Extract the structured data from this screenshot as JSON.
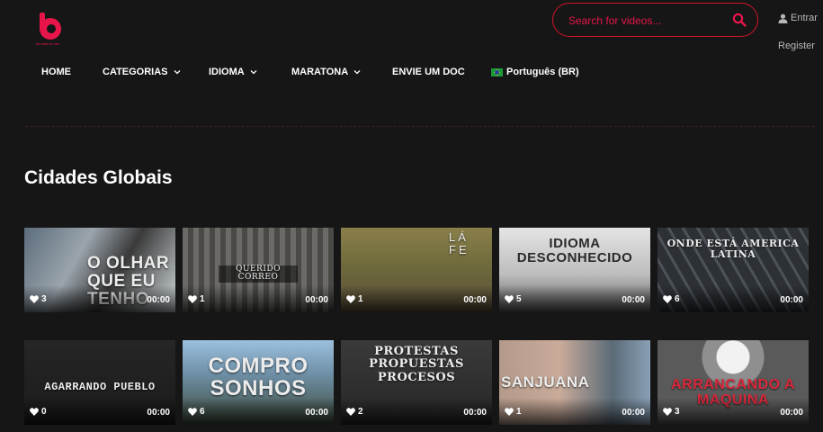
{
  "logo": {
    "tagline": "bendita ao seu"
  },
  "search": {
    "placeholder": "Search for videos..."
  },
  "account": {
    "login_label": "Entrar",
    "register_label": "Register"
  },
  "nav": {
    "home": "HOME",
    "categorias": "CATEGORIAS",
    "idioma": "IDIOMA",
    "maratona": "MARATONA",
    "envie": "ENVIE UM DOC",
    "language": "Português (BR)"
  },
  "section": {
    "title": "Cidades Globais"
  },
  "videos": [
    {
      "title": "O OLHAR QUE EU TENHO",
      "likes": "3",
      "duration": "00:00"
    },
    {
      "title": "QUERIDO CORREO",
      "likes": "1",
      "duration": "00:00"
    },
    {
      "title": "LÁ FE",
      "likes": "1",
      "duration": "00:00"
    },
    {
      "title": "IDIOMA DESCONHECIDO",
      "likes": "5",
      "duration": "00:00"
    },
    {
      "title": "ONDE ESTÁ AMERICA LATINA",
      "likes": "6",
      "duration": "00:00"
    },
    {
      "title": "AGARRANDO PUEBLO",
      "likes": "0",
      "duration": "00:00"
    },
    {
      "title": "COMPRO SONHOS",
      "likes": "6",
      "duration": "00:00"
    },
    {
      "title": "PROTESTAS PROPUESTAS PROCESOS",
      "likes": "2",
      "duration": "00:00"
    },
    {
      "title": "SANJUANA",
      "likes": "1",
      "duration": "00:00"
    },
    {
      "title": "ARRANCANDO A MAQUINA",
      "likes": "3",
      "duration": "00:00"
    }
  ],
  "colors": {
    "accent": "#e8154a",
    "background": "#161616"
  }
}
